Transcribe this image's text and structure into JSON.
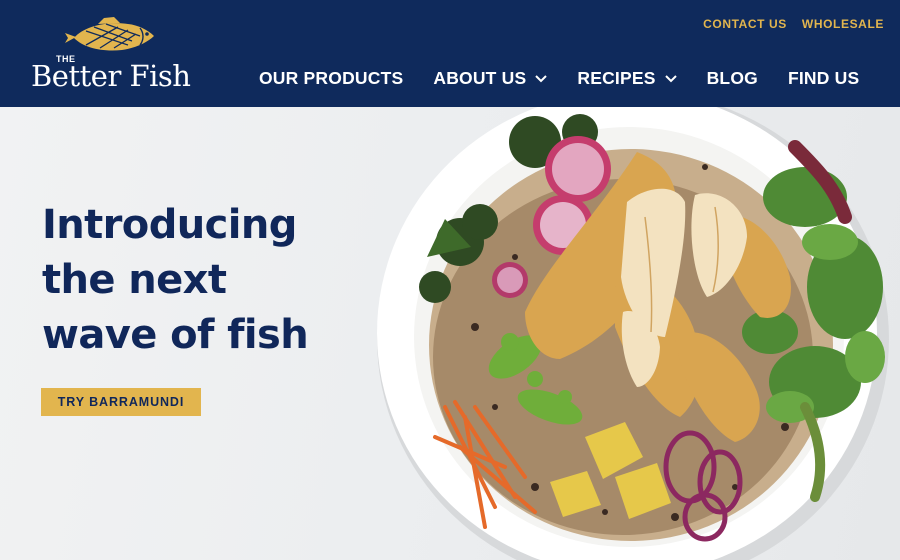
{
  "brand": {
    "logo_small": "THE",
    "logo_name": "Better Fish",
    "logo_mark": "fish-logo-icon"
  },
  "util_nav": [
    "CONTACT US",
    "WHOLESALE"
  ],
  "main_nav": [
    {
      "label": "OUR PRODUCTS",
      "dropdown": false
    },
    {
      "label": "ABOUT US",
      "dropdown": true
    },
    {
      "label": "RECIPES",
      "dropdown": true
    },
    {
      "label": "BLOG",
      "dropdown": false
    },
    {
      "label": "FIND US",
      "dropdown": false
    }
  ],
  "hero": {
    "title_lines": [
      "Introducing",
      "the next",
      "wave of fish"
    ],
    "cta_label": "TRY BARRAMUNDI",
    "image": "fish-grain-bowl-photo"
  },
  "colors": {
    "navy": "#0f2a5c",
    "gold": "#e2b54e",
    "title_navy": "#10275a",
    "background": "#eceef0"
  }
}
